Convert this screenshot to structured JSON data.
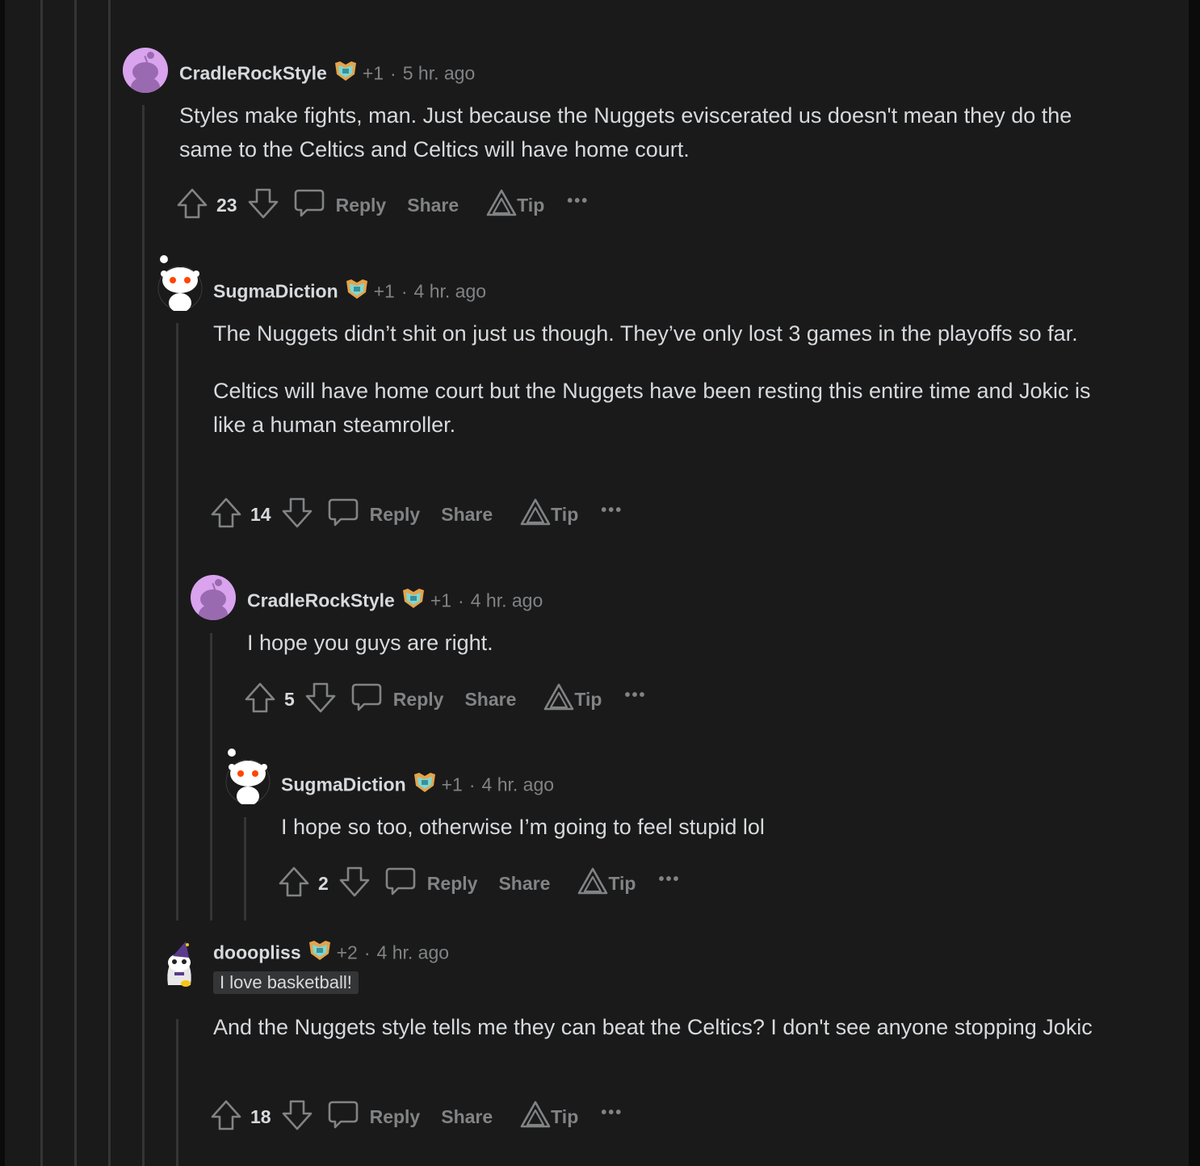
{
  "comments": [
    {
      "username": "CradleRockStyle",
      "karma": "+1",
      "sep": "·",
      "time": "5 hr. ago",
      "avatar": "purple-snoo",
      "paragraphs": [
        "Styles make fights, man. Just because the Nuggets eviscerated us doesn't mean they do the same to the Celtics and Celtics will have home court."
      ],
      "votes": "23",
      "reply": "Reply",
      "share": "Share",
      "tip": "Tip",
      "more": "•••"
    },
    {
      "username": "SugmaDiction",
      "karma": "+1",
      "sep": "·",
      "time": "4 hr. ago",
      "avatar": "white-snoo",
      "paragraphs": [
        "The Nuggets didn’t shit on just us though. They’ve only lost 3 games in the playoffs so far.",
        "Celtics will have home court but the Nuggets have been resting this entire time and Jokic is like a human steamroller."
      ],
      "votes": "14",
      "reply": "Reply",
      "share": "Share",
      "tip": "Tip",
      "more": "•••"
    },
    {
      "username": "CradleRockStyle",
      "karma": "+1",
      "sep": "·",
      "time": "4 hr. ago",
      "avatar": "purple-snoo",
      "paragraphs": [
        "I hope you guys are right."
      ],
      "votes": "5",
      "reply": "Reply",
      "share": "Share",
      "tip": "Tip",
      "more": "•••"
    },
    {
      "username": "SugmaDiction",
      "karma": "+1",
      "sep": "·",
      "time": "4 hr. ago",
      "avatar": "white-snoo",
      "paragraphs": [
        "I hope so too, otherwise I’m going to feel stupid lol"
      ],
      "votes": "2",
      "reply": "Reply",
      "share": "Share",
      "tip": "Tip",
      "more": "•••"
    },
    {
      "username": "dooopliss",
      "karma": "+2",
      "sep": "·",
      "time": "4 hr. ago",
      "avatar": "wizard-snoo",
      "flair": "I love basketball!",
      "paragraphs": [
        "And the Nuggets style tells me they can beat the Celtics? I don't see anyone stopping Jokic"
      ],
      "votes": "18",
      "reply": "Reply",
      "share": "Share",
      "tip": "Tip",
      "more": "•••"
    }
  ],
  "colors": {
    "background": "#1a1a1b",
    "text": "#d7dadc",
    "muted": "#818384",
    "thread_line": "#343536",
    "avatar_purple": "#d9a3ee"
  }
}
